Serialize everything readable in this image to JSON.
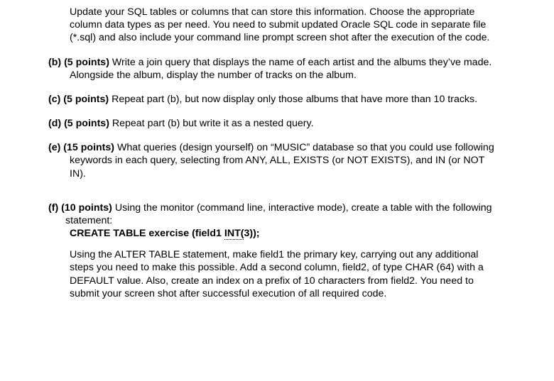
{
  "intro": "Update your SQL tables or columns that can store this information. Choose the appropriate column data types as per need. You need to submit updated Oracle SQL code in separate file (*.sql) and also include your command line prompt screen shot after the execution of the code.",
  "items": {
    "b": {
      "label": "(b)",
      "points": "(5 points)",
      "text": "Write a join query that displays the name of each artist and the albums they’ve made. Alongside the album, display the number of tracks on the album."
    },
    "c": {
      "label": "(c)",
      "points": "(5 points)",
      "text": "Repeat part (b), but now display only those albums that have more than 10 tracks."
    },
    "d": {
      "label": "(d)",
      "points": "(5 points)",
      "text": "Repeat part (b) but write it as a nested query."
    },
    "e": {
      "label": "(e)",
      "points": "(15 points)",
      "text": "What queries (design yourself) on “MUSIC” database so that you could use following keywords in each query, selecting from ANY, ALL, EXISTS (or NOT EXISTS), and IN (or NOT IN)."
    },
    "f": {
      "label": "(f)",
      "points": "(10 points)",
      "lead": "Using the monitor (command line, interactive mode), create a table with the following statement:",
      "statement_pre": "CREATE TABLE exercise (field1 ",
      "statement_link": "INT(",
      "statement_post": "3));",
      "body": "Using the ALTER TABLE statement, make field1 the primary key, carrying out any additional steps you need to make this possible. Add a second column, field2, of type CHAR (64) with a DEFAULT value. Also, create an index on a prefix of 10 characters from field2. You need to submit your screen shot after successful execution of all required code."
    }
  }
}
